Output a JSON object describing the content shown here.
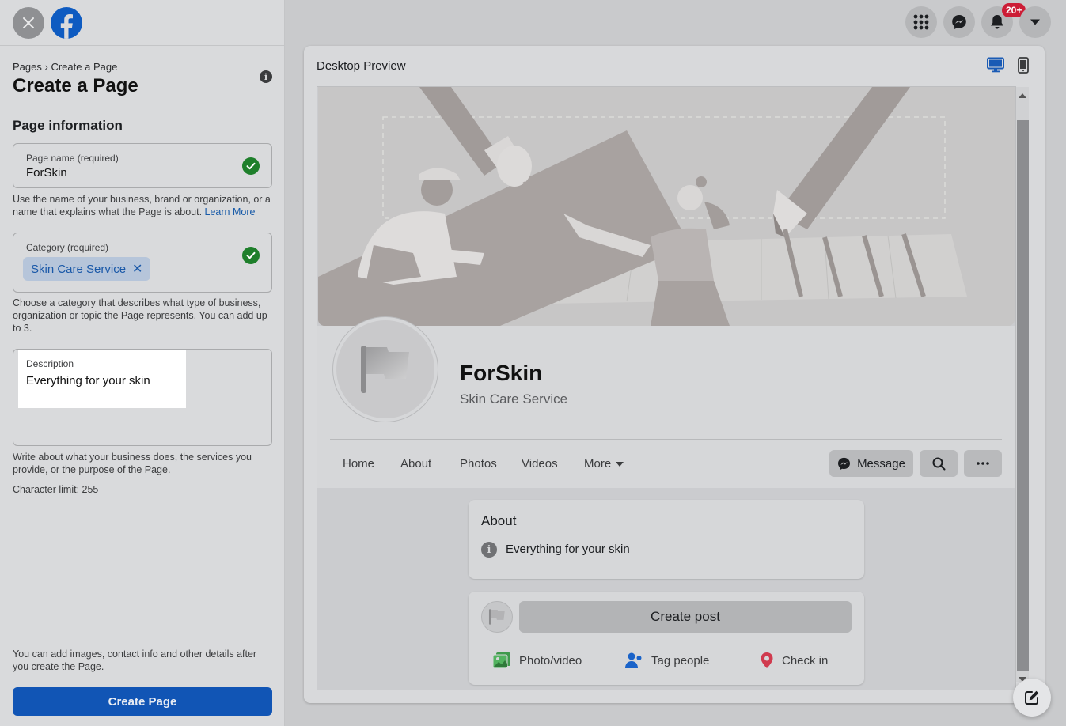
{
  "left_panel": {
    "breadcrumb": [
      "Pages",
      "›",
      "Create a Page"
    ],
    "title": "Create a Page",
    "section_title": "Page information",
    "page_name": {
      "label": "Page name (required)",
      "value": "ForSkin",
      "helper": "Use the name of your business, brand or organization, or a name that explains what the Page is about.",
      "helper_link": "Learn More"
    },
    "category": {
      "label": "Category (required)",
      "chip": "Skin Care Service",
      "chip_remove": "✕",
      "helper": "Choose a category that describes what type of business, organization or topic the Page represents. You can add up to 3."
    },
    "description": {
      "label": "Description",
      "value": "Everything for your skin",
      "helper": "Write about what your business does, the services you provide, or the purpose of the Page.",
      "char_limit": "Character limit: 255"
    },
    "footer_note": "You can add images, contact info and other details after you create the Page.",
    "create_button": "Create Page"
  },
  "top_bar": {
    "notification_badge": "20+",
    "icons": [
      "menu-grid-icon",
      "messenger-icon",
      "bell-icon",
      "caret-down-icon"
    ]
  },
  "preview": {
    "title": "Desktop Preview",
    "page_name": "ForSkin",
    "page_category": "Skin Care Service",
    "tabs": [
      "Home",
      "About",
      "Photos",
      "Videos",
      "More"
    ],
    "message_button": "Message",
    "about": {
      "title": "About",
      "text": "Everything for your skin"
    },
    "post": {
      "create_post": "Create post",
      "actions": [
        "Photo/video",
        "Tag people",
        "Check in"
      ]
    }
  },
  "colors": {
    "brand_blue": "#1155b5",
    "check_green": "#1e7f2b",
    "badge_red": "#cc1d36",
    "link_blue": "#175aa8"
  }
}
